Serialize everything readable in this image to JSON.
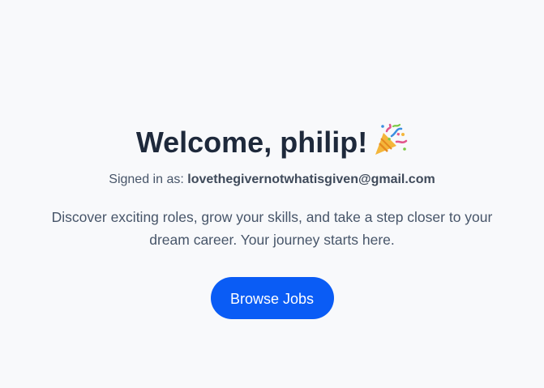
{
  "welcome": {
    "greeting": "Welcome, philip!",
    "emoji_icon": "party-popper-icon"
  },
  "account": {
    "signed_in_label": "Signed in as:",
    "email": "lovethegivernotwhatisgiven@gmail.com"
  },
  "tagline": "Discover exciting roles, grow your skills, and take a step closer to your dream career. Your journey starts here.",
  "actions": {
    "browse_jobs_label": "Browse Jobs"
  },
  "colors": {
    "background": "#f8f9fb",
    "heading": "#1e293b",
    "body_text": "#475569",
    "button_bg": "#0a5cf5",
    "button_text": "#ffffff"
  }
}
